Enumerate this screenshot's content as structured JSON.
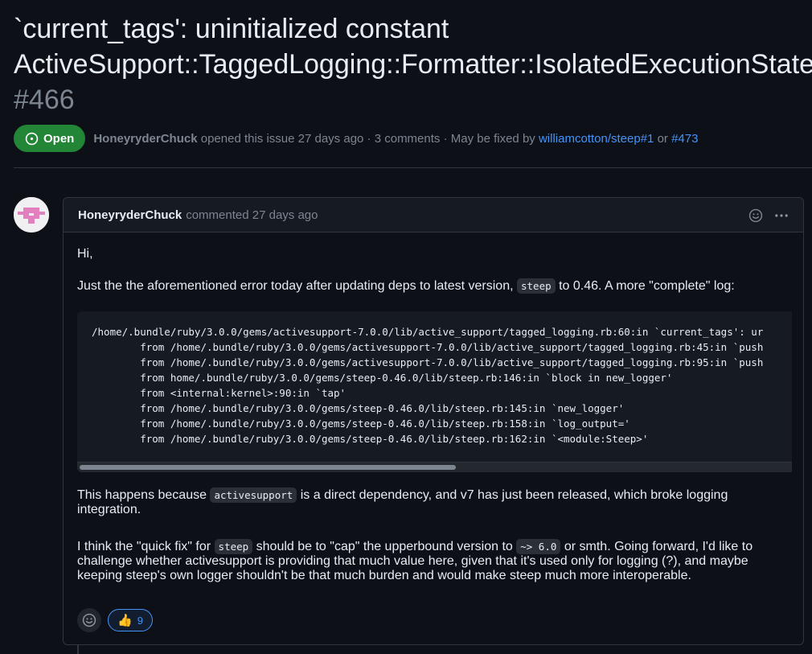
{
  "issue": {
    "title_line1": "`current_tags': uninitialized constant",
    "title_line2": "ActiveSupport::TaggedLogging::Formatter::IsolatedExecutionState",
    "number": "#466",
    "state": "Open",
    "author": "HoneyryderChuck",
    "opened_text": "opened this issue 27 days ago · 3 comments · May be fixed by",
    "fix_link_1": "williamcotton/steep#1",
    "fix_or": "or",
    "fix_link_2": "#473"
  },
  "comment": {
    "author": "HoneyryderChuck",
    "action": "commented 27 days ago",
    "greeting": "Hi,",
    "p1_before": "Just the the aforementioned error today after updating deps to latest version,",
    "p1_code": "steep",
    "p1_after": "to 0.46. A more \"complete\" log:",
    "log_lines": [
      "/home/.bundle/ruby/3.0.0/gems/activesupport-7.0.0/lib/active_support/tagged_logging.rb:60:in `current_tags': ur",
      "        from /home/.bundle/ruby/3.0.0/gems/activesupport-7.0.0/lib/active_support/tagged_logging.rb:45:in `push",
      "        from /home/.bundle/ruby/3.0.0/gems/activesupport-7.0.0/lib/active_support/tagged_logging.rb:95:in `push",
      "        from home/.bundle/ruby/3.0.0/gems/steep-0.46.0/lib/steep.rb:146:in `block in new_logger'",
      "        from <internal:kernel>:90:in `tap'",
      "        from /home/.bundle/ruby/3.0.0/gems/steep-0.46.0/lib/steep.rb:145:in `new_logger'",
      "        from /home/.bundle/ruby/3.0.0/gems/steep-0.46.0/lib/steep.rb:158:in `log_output='",
      "        from /home/.bundle/ruby/3.0.0/gems/steep-0.46.0/lib/steep.rb:162:in `<module:Steep>'"
    ],
    "p2_before": "This happens because",
    "p2_code": "activesupport",
    "p2_after": "is a direct dependency, and v7 has just been released, which broke logging integration.",
    "p3_a": "I think the \"quick fix\" for",
    "p3_code1": "steep",
    "p3_b": "should be to \"cap\" the upperbound version to",
    "p3_code2": "~> 6.0",
    "p3_c": "or smth. Going forward, I'd like to challenge whether activesupport is providing that much value here, given that it's used only for logging (?), and maybe keeping steep's own logger shouldn't be that much burden and would make steep much more interoperable.",
    "reaction_emoji": "👍",
    "reaction_count": "9"
  },
  "colors": {
    "background": "#0d1117",
    "open_badge": "#238636",
    "link": "#4493f8",
    "muted": "#7d8590"
  },
  "icons": [
    "issue-open-icon",
    "smiley-icon",
    "kebab-menu-icon",
    "add-reaction-icon",
    "thumbs-up-icon"
  ]
}
